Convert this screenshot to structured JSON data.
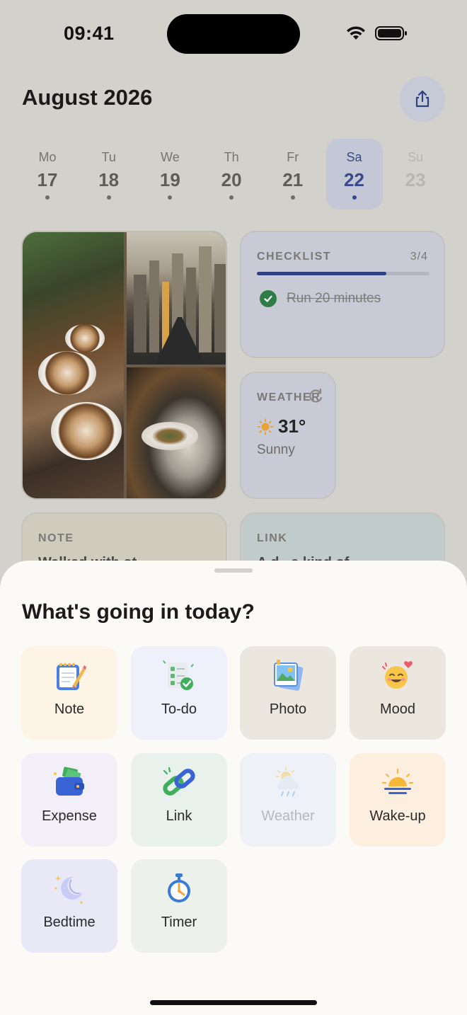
{
  "status_bar": {
    "time": "09:41"
  },
  "header": {
    "month": "August 2026"
  },
  "week": [
    {
      "name": "Mo",
      "num": "17",
      "state": "normal"
    },
    {
      "name": "Tu",
      "num": "18",
      "state": "normal"
    },
    {
      "name": "We",
      "num": "19",
      "state": "normal"
    },
    {
      "name": "Th",
      "num": "20",
      "state": "normal"
    },
    {
      "name": "Fr",
      "num": "21",
      "state": "normal"
    },
    {
      "name": "Sa",
      "num": "22",
      "state": "selected"
    },
    {
      "name": "Su",
      "num": "23",
      "state": "faded"
    }
  ],
  "checklist": {
    "label": "CHECKLIST",
    "count": "3/4",
    "progress": 0.75,
    "item": "Run 20 minutes"
  },
  "weather_card": {
    "label": "WEATHER",
    "temp": "31°",
    "condition": "Sunny"
  },
  "note_card": {
    "label": "NOTE",
    "preview": "Walked with ot..."
  },
  "link_card": {
    "label": "LINK",
    "preview": "A d...e kind of..."
  },
  "sheet": {
    "title": "What's going in today?",
    "tiles": [
      {
        "label": "Note",
        "icon": "note-icon",
        "bg": "#fdf4e6",
        "enabled": true
      },
      {
        "label": "To-do",
        "icon": "todo-icon",
        "bg": "#eef0fb",
        "enabled": true
      },
      {
        "label": "Photo",
        "icon": "photo-icon",
        "bg": "#ebe7df",
        "enabled": true
      },
      {
        "label": "Mood",
        "icon": "mood-icon",
        "bg": "#ebe7df",
        "enabled": true
      },
      {
        "label": "Expense",
        "icon": "expense-icon",
        "bg": "#f2eff8",
        "enabled": true
      },
      {
        "label": "Link",
        "icon": "link-icon",
        "bg": "#e8f1ec",
        "enabled": true
      },
      {
        "label": "Weather",
        "icon": "weather-icon",
        "bg": "#eef2f8",
        "enabled": false
      },
      {
        "label": "Wake-up",
        "icon": "sunrise-icon",
        "bg": "#fdefe0",
        "enabled": true
      },
      {
        "label": "Bedtime",
        "icon": "moon-icon",
        "bg": "#e8e8f6",
        "enabled": true
      },
      {
        "label": "Timer",
        "icon": "timer-icon",
        "bg": "#ecf1ec",
        "enabled": true
      }
    ]
  },
  "colors": {
    "accent": "#2f4083",
    "check_green": "#2f7d46",
    "sheet_bg": "#fbfaf7",
    "dim_bg": "#d3d1cc"
  }
}
